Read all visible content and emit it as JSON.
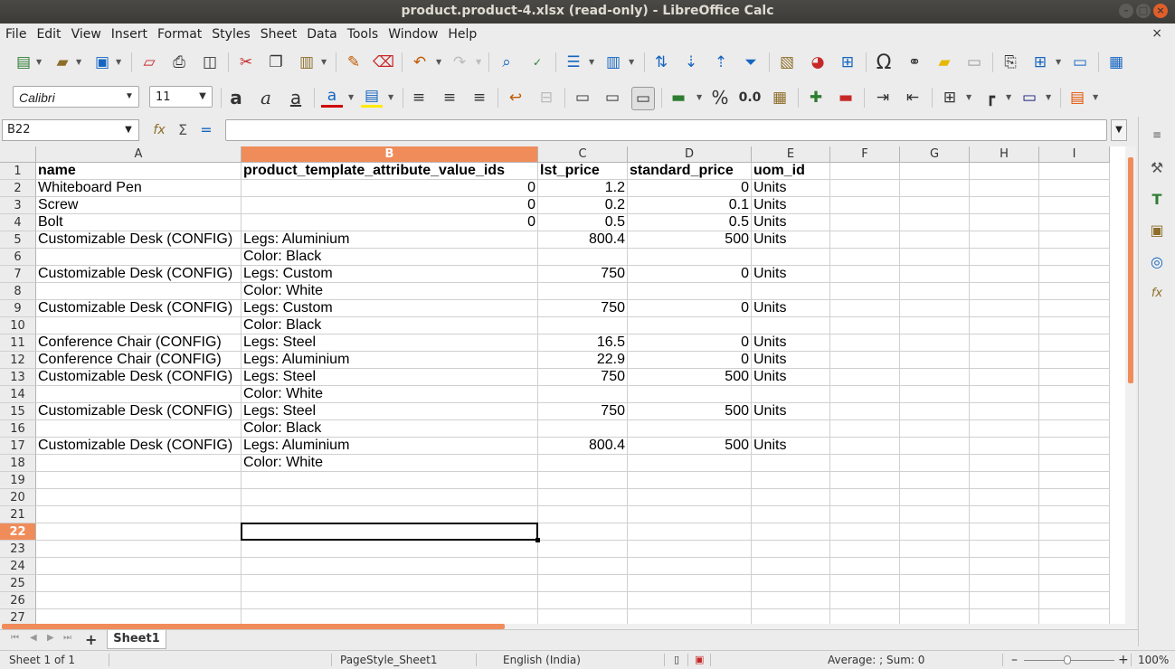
{
  "window": {
    "title": "product.product-4.xlsx (read-only) - LibreOffice Calc",
    "minimize_glyph": "–",
    "maximize_glyph": "□",
    "close_glyph": "×",
    "doc_close_glyph": "×"
  },
  "menu": [
    "File",
    "Edit",
    "View",
    "Insert",
    "Format",
    "Styles",
    "Sheet",
    "Data",
    "Tools",
    "Window",
    "Help"
  ],
  "format_toolbar": {
    "font_name": "Calibri",
    "font_size": "11",
    "bold_glyph": "a",
    "italic_glyph": "a",
    "underline_glyph": "a",
    "percent_glyph": "%",
    "number_format_glyph": "0.0"
  },
  "formula_bar": {
    "name_box": "B22",
    "function_wizard_glyph": "fx",
    "sum_glyph": "Σ",
    "equals_glyph": "=",
    "content": ""
  },
  "grid": {
    "columns": [
      "A",
      "B",
      "C",
      "D",
      "E",
      "F",
      "G",
      "H",
      "I"
    ],
    "selected_column": "B",
    "selected_row": 22,
    "row_numbers": [
      1,
      2,
      3,
      4,
      5,
      6,
      7,
      8,
      9,
      10,
      11,
      12,
      13,
      14,
      15,
      16,
      17,
      18,
      19,
      20,
      21,
      22,
      23,
      24,
      25,
      26,
      27
    ],
    "rows": [
      [
        "name",
        "product_template_attribute_value_ids",
        "lst_price",
        "standard_price",
        "uom_id"
      ],
      [
        "Whiteboard Pen",
        "0",
        "1.2",
        "0",
        "Units"
      ],
      [
        "Screw",
        "0",
        "0.2",
        "0.1",
        "Units"
      ],
      [
        "Bolt",
        "0",
        "0.5",
        "0.5",
        "Units"
      ],
      [
        "Customizable Desk (CONFIG)",
        "Legs: Aluminium",
        "800.4",
        "500",
        "Units"
      ],
      [
        "",
        "Color: Black",
        "",
        "",
        ""
      ],
      [
        "Customizable Desk (CONFIG)",
        "Legs: Custom",
        "750",
        "0",
        "Units"
      ],
      [
        "",
        "Color: White",
        "",
        "",
        ""
      ],
      [
        "Customizable Desk (CONFIG)",
        "Legs: Custom",
        "750",
        "0",
        "Units"
      ],
      [
        "",
        "Color: Black",
        "",
        "",
        ""
      ],
      [
        "Conference Chair (CONFIG)",
        "Legs: Steel",
        "16.5",
        "0",
        "Units"
      ],
      [
        "Conference Chair (CONFIG)",
        "Legs: Aluminium",
        "22.9",
        "0",
        "Units"
      ],
      [
        "Customizable Desk (CONFIG)",
        "Legs: Steel",
        "750",
        "500",
        "Units"
      ],
      [
        "",
        "Color: White",
        "",
        "",
        ""
      ],
      [
        "Customizable Desk (CONFIG)",
        "Legs: Steel",
        "750",
        "500",
        "Units"
      ],
      [
        "",
        "Color: Black",
        "",
        "",
        ""
      ],
      [
        "Customizable Desk (CONFIG)",
        "Legs: Aluminium",
        "800.4",
        "500",
        "Units"
      ],
      [
        "",
        "Color: White",
        "",
        "",
        ""
      ]
    ]
  },
  "tabs": {
    "add_glyph": "+",
    "sheets": [
      "Sheet1"
    ]
  },
  "status": {
    "sheet_info": "Sheet 1 of 1",
    "page_style": "PageStyle_Sheet1",
    "language": "English (India)",
    "aggregate": "Average: ; Sum: 0",
    "zoom_minus": "–",
    "zoom_plus": "+",
    "zoom": "100%"
  }
}
